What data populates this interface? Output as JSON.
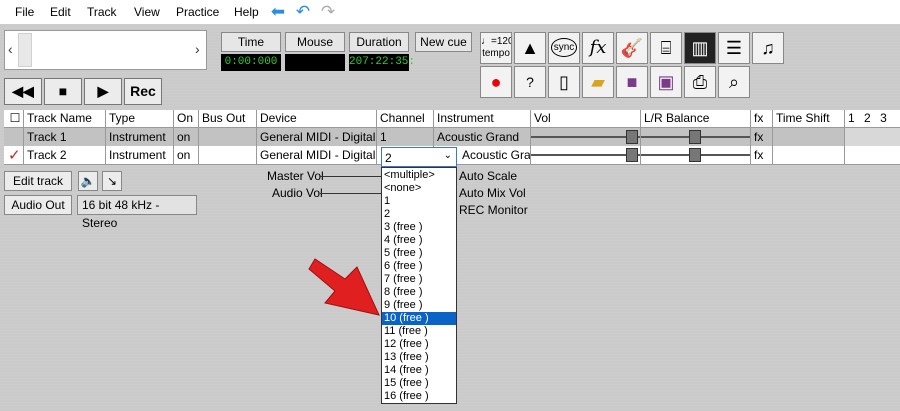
{
  "menu": [
    "File",
    "Edit",
    "Track",
    "View",
    "Practice",
    "Help"
  ],
  "toolbar_icons": [
    "back-arrow-icon",
    "undo-icon",
    "redo-icon"
  ],
  "transport": {
    "time_label": "Time",
    "mouse_label": "Mouse",
    "duration_label": "Duration",
    "newcue_label": "New cue",
    "time_value": "0:00:000",
    "mouse_value": "",
    "duration_value": "207:22:35:",
    "rewind_label": "◀◀",
    "stop_label": "■",
    "play_label": "▶",
    "rec_label": "Rec"
  },
  "icons": {
    "tempo_note": "♩=120",
    "tempo_label": "tempo",
    "sync_label": "sync",
    "fx_label": "fx"
  },
  "table": {
    "headers": [
      "Track Name",
      "Type",
      "On",
      "Bus Out",
      "Device",
      "Channel",
      "Instrument",
      "Vol",
      "L/R Balance",
      "fx",
      "Time Shift",
      "1",
      "2",
      "3"
    ],
    "rows": [
      {
        "name": "Track 1",
        "type": "Instrument",
        "on": "on",
        "bus": "",
        "device": "General MIDI - Digital K",
        "channel": "1",
        "instrument": "Acoustic Grand",
        "fx": "fx"
      },
      {
        "name": "Track 2",
        "type": "Instrument",
        "on": "on",
        "bus": "",
        "device": "General MIDI - Digital K",
        "channel": "2",
        "instrument": "Acoustic Grand",
        "fx": "fx"
      }
    ]
  },
  "lower": {
    "edit_track": "Edit track",
    "audio_out": "Audio Out",
    "audio_format": "16 bit 48 kHz - Stereo",
    "master_vol": "Master Vol",
    "audio_vol": "Audio Vol",
    "auto_scale": "Auto Scale",
    "auto_mix_vol": "Auto Mix Vol",
    "rec_monitor": "REC Monitor"
  },
  "channel_dropdown": {
    "selected_value": "2",
    "options": [
      "<multiple>",
      "<none>",
      "1",
      "2",
      "3  (free )",
      "4  (free )",
      "5  (free )",
      "6  (free )",
      "7  (free )",
      "8  (free )",
      "9  (free )",
      "10  (free )",
      "11  (free )",
      "12  (free )",
      "13  (free )",
      "14  (free )",
      "15  (free )",
      "16  (free )"
    ],
    "highlighted": "10  (free )"
  },
  "colors": {
    "lcd_text": "#33cc33",
    "selection": "#0a64c8",
    "pointer_arrow": "#e02020",
    "check": "#cc2222"
  }
}
